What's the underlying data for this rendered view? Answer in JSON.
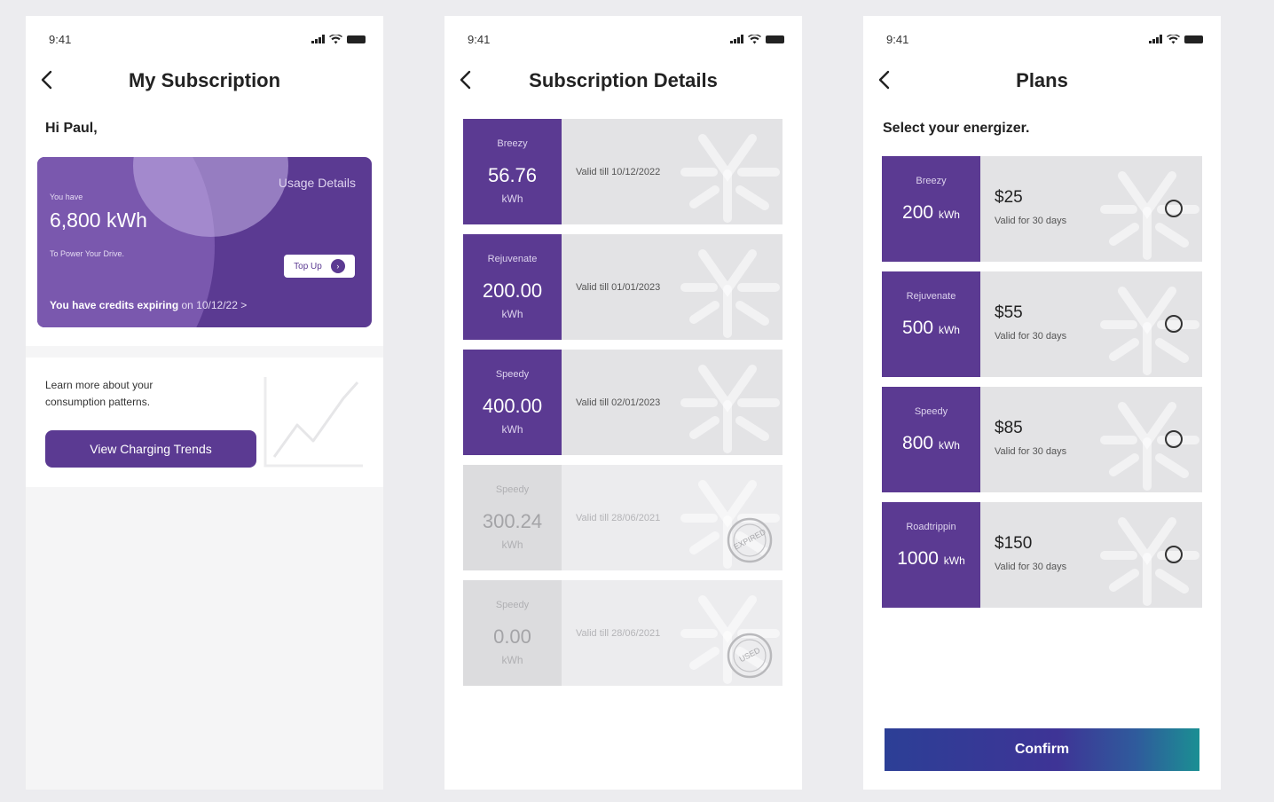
{
  "status_time": "9:41",
  "screen1": {
    "title": "My Subscription",
    "greeting": "Hi Paul,",
    "card": {
      "you_have": "You have",
      "amount": "6,800 kWh",
      "subtext": "To Power Your Drive.",
      "usage_link": "Usage Details",
      "topup_label": "Top Up",
      "expire_bold": "You have credits expiring",
      "expire_rest": "on 10/12/22 >"
    },
    "learn": {
      "text": "Learn more about your consumption patterns.",
      "button": "View Charging Trends"
    }
  },
  "screen2": {
    "title": "Subscription Details",
    "items": [
      {
        "name": "Breezy",
        "value": "56.76",
        "unit": "kWh",
        "valid": "Valid till 10/12/2022"
      },
      {
        "name": "Rejuvenate",
        "value": "200.00",
        "unit": "kWh",
        "valid": "Valid till 01/01/2023"
      },
      {
        "name": "Speedy",
        "value": "400.00",
        "unit": "kWh",
        "valid": "Valid till 02/01/2023"
      },
      {
        "name": "Speedy",
        "value": "300.24",
        "unit": "kWh",
        "valid": "Valid till 28/06/2021",
        "stamp": "EXPIRED"
      },
      {
        "name": "Speedy",
        "value": "0.00",
        "unit": "kWh",
        "valid": "Valid till 28/06/2021",
        "stamp": "USED"
      }
    ]
  },
  "screen3": {
    "title": "Plans",
    "subtitle": "Select your energizer.",
    "unit": "kWh",
    "plans": [
      {
        "name": "Breezy",
        "value": "200",
        "price": "$25",
        "validity": "Valid for 30 days"
      },
      {
        "name": "Rejuvenate",
        "value": "500",
        "price": "$55",
        "validity": "Valid for 30 days"
      },
      {
        "name": "Speedy",
        "value": "800",
        "price": "$85",
        "validity": "Valid for 30 days"
      },
      {
        "name": "Roadtrippin",
        "value": "1000",
        "price": "$150",
        "validity": "Valid for 30 days"
      }
    ],
    "confirm": "Confirm"
  },
  "colors": {
    "brand_purple": "#5b3a92",
    "card_grey": "#e3e3e5",
    "confirm_start": "#2c3f96",
    "confirm_end": "#1b8f93"
  }
}
